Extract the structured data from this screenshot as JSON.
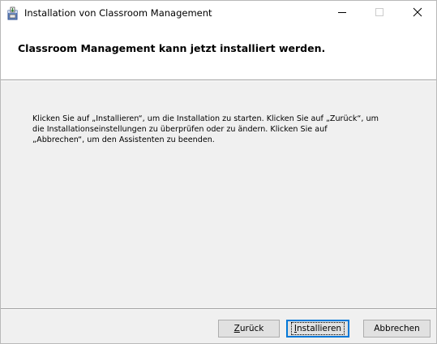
{
  "window": {
    "title": "Installation von Classroom Management",
    "app_icon": "installer-package-icon",
    "controls": {
      "minimize": "minimize-icon",
      "maximize": "maximize-icon",
      "close": "close-icon"
    }
  },
  "header": {
    "title": "Classroom Management kann jetzt installiert werden."
  },
  "body": {
    "line1": "Klicken Sie auf „Installieren“, um die Installation zu starten. Klicken Sie auf „Zurück“, um",
    "line2": "die Installationseinstellungen zu überprüfen oder zu ändern. Klicken Sie auf",
    "line3": "„Abbrechen“, um den Assistenten zu beenden."
  },
  "buttons": {
    "back": {
      "mnemonic": "Z",
      "rest": "urück"
    },
    "install": {
      "mnemonic": "I",
      "rest": "nstallieren",
      "default": true
    },
    "cancel": {
      "label": "Abbrechen"
    }
  },
  "colors": {
    "accent": "#0078d7",
    "dialog_bg": "#f0f0f0",
    "header_bg": "#ffffff"
  }
}
